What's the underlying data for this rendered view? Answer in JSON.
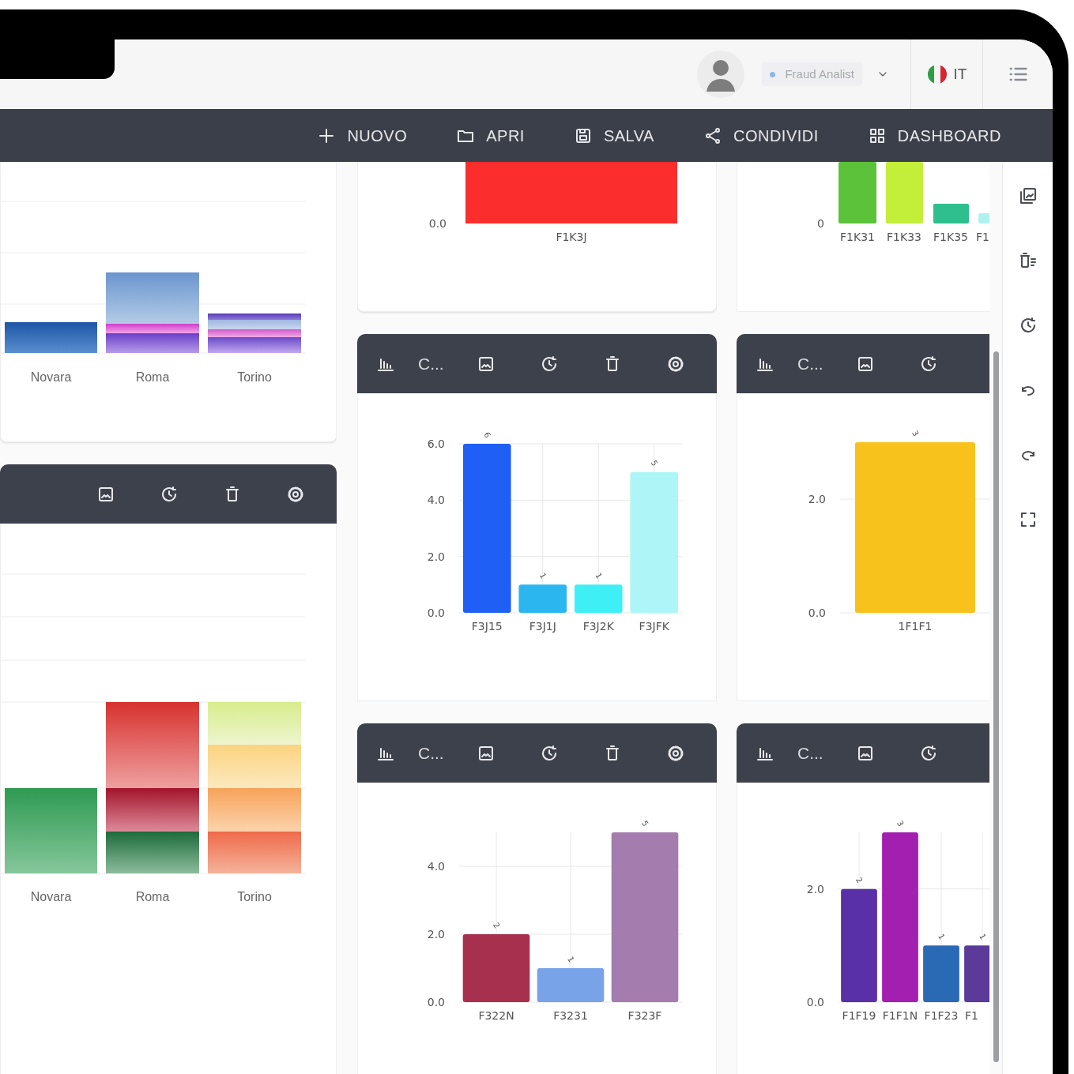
{
  "header": {
    "role_badge": "Fraud Analist",
    "language": "IT"
  },
  "toolbar": {
    "buttons": [
      {
        "kind": "new",
        "label": "NUOVO"
      },
      {
        "kind": "open",
        "label": "APRI"
      },
      {
        "kind": "save",
        "label": "SALVA"
      },
      {
        "kind": "share",
        "label": "CONDIVIDI"
      },
      {
        "kind": "dashboard",
        "label": "DASHBOARD"
      }
    ]
  },
  "columns": [
    {
      "widgets": [
        {
          "has_header": false,
          "kind": "stacked_picture",
          "categories": [
            "Novara",
            "Roma",
            "Torino"
          ]
        },
        {
          "has_header": true,
          "kind": "stacked_picture",
          "categories": [
            "Novara",
            "Roma",
            "Torino"
          ]
        }
      ]
    },
    {
      "widgets": [
        {
          "has_header": false,
          "kind": "bar_picture",
          "tick_labels": [
            "0.0"
          ],
          "categories": [
            "F1K3J"
          ]
        },
        {
          "has_header": true,
          "title": "C...",
          "kind": "chart",
          "chart_data": {
            "type": "bar",
            "categories": [
              "F3J15",
              "F3J1J",
              "F3J2K",
              "F3JFK"
            ],
            "series": [
              {
                "color": "#1f5ff5",
                "values": [
                  6,
                  null,
                  null,
                  null
                ]
              },
              {
                "color": "#2bb6f0",
                "values": [
                  null,
                  1,
                  null,
                  null
                ]
              },
              {
                "color": "#3ef0f5",
                "values": [
                  null,
                  null,
                  1,
                  null
                ]
              },
              {
                "color": "#aef5f8",
                "values": [
                  null,
                  null,
                  null,
                  5
                ]
              }
            ],
            "ylim": [
              0,
              6
            ],
            "yticks": [
              {
                "value": 0,
                "label": "0.0"
              },
              {
                "value": 2,
                "label": "2.0"
              },
              {
                "value": 4,
                "label": "4.0"
              },
              {
                "value": 6,
                "label": "6.0"
              }
            ],
            "grid": true,
            "data_labels": true
          }
        },
        {
          "has_header": true,
          "title": "C...",
          "kind": "chart",
          "chart_data": {
            "type": "bar",
            "categories": [
              "F322N",
              "F3231",
              "F323F"
            ],
            "series": [
              {
                "color": "#a8304f",
                "values": [
                  2,
                  null,
                  null
                ]
              },
              {
                "color": "#79a3e8",
                "values": [
                  null,
                  1,
                  null
                ]
              },
              {
                "color": "#a47cad",
                "values": [
                  null,
                  null,
                  5
                ]
              }
            ],
            "ylim": [
              0,
              5
            ],
            "yticks": [
              {
                "value": 0,
                "label": "0.0"
              },
              {
                "value": 2,
                "label": "2.0"
              },
              {
                "value": 4,
                "label": "4.0"
              }
            ],
            "grid": true,
            "data_labels": true
          }
        }
      ]
    },
    {
      "widgets": [
        {
          "has_header": false,
          "kind": "bar_picture",
          "tick_labels": [
            "0"
          ],
          "categories": [
            "F1K31",
            "F1K33",
            "F1K35",
            "F1"
          ]
        },
        {
          "has_header": true,
          "title": "C...",
          "kind": "chart",
          "chart_data": {
            "type": "bar",
            "categories": [
              "1F1F1"
            ],
            "series": [
              {
                "color": "#f8c21c",
                "values": [
                  3
                ]
              }
            ],
            "ylim": [
              0,
              3
            ],
            "yticks": [
              {
                "value": 0,
                "label": "0.0"
              },
              {
                "value": 2,
                "label": "2.0"
              }
            ],
            "grid": true,
            "data_labels": true
          }
        },
        {
          "has_header": true,
          "title": "C...",
          "kind": "chart",
          "chart_data": {
            "type": "bar",
            "categories": [
              "F1F19",
              "F1F1N",
              "F1F23",
              "F1"
            ],
            "series": [
              {
                "color": "#5a30a8",
                "values": [
                  2,
                  null,
                  null,
                  null
                ]
              },
              {
                "color": "#a21fb0",
                "values": [
                  null,
                  3,
                  null,
                  null
                ]
              },
              {
                "color": "#2a6ab5",
                "values": [
                  null,
                  null,
                  1,
                  null
                ]
              },
              {
                "color": "#5b3a9a",
                "values": [
                  null,
                  null,
                  null,
                  1
                ]
              }
            ],
            "ylim": [
              0,
              3
            ],
            "yticks": [
              {
                "value": 0,
                "label": "0.0"
              },
              {
                "value": 2,
                "label": "2.0"
              }
            ],
            "grid": true,
            "data_labels": true
          }
        }
      ]
    }
  ]
}
